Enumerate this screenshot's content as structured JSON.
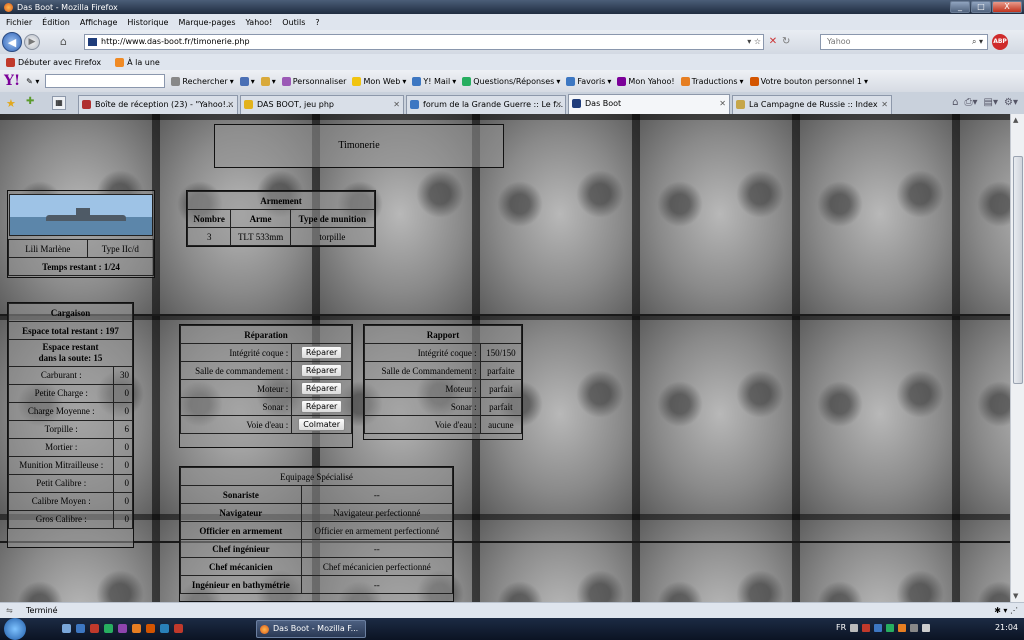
{
  "window": {
    "title": "Das Boot - Mozilla Firefox",
    "min": "_",
    "max": "□",
    "close": "X"
  },
  "menu": [
    "Fichier",
    "Édition",
    "Affichage",
    "Historique",
    "Marque-pages",
    "Yahoo!",
    "Outils",
    "?"
  ],
  "nav": {
    "url": "http://www.das-boot.fr/timonerie.php",
    "search_placeholder": "Yahoo"
  },
  "bookmarks": [
    "Débuter avec Firefox",
    "À la une"
  ],
  "yahoo_toolbar": {
    "logo": "Y!",
    "items": [
      "Rechercher",
      "Personnaliser",
      "Mon Web",
      "Y! Mail",
      "Questions/Réponses",
      "Favoris",
      "Mon Yahoo!",
      "Traductions",
      "Votre bouton personnel 1"
    ]
  },
  "tabs": [
    {
      "label": "Boîte de réception (23) - \"Yahoo!...",
      "color": "#b03030"
    },
    {
      "label": "DAS BOOT, jeu php",
      "color": "#e2b21c"
    },
    {
      "label": "forum de la Grande Guerre :: Le f...",
      "color": "#3d77c2"
    },
    {
      "label": "Das Boot",
      "color": "#1f3c7a",
      "active": true
    },
    {
      "label": "La Campagne de Russie :: Index",
      "color": "#c6a64a"
    }
  ],
  "page": {
    "title": "Timonerie",
    "sub": {
      "name": "Lili Marlène",
      "type": "Type IIc/d",
      "time_left": "Temps restant : 1/24"
    },
    "armement": {
      "title": "Armement",
      "headers": [
        "Nombre",
        "Arme",
        "Type de munition"
      ],
      "rows": [
        [
          "3",
          "TLT 533mm",
          "torpille"
        ]
      ]
    },
    "cargaison": {
      "title": "Cargaison",
      "espace_total": "Espace total restant : 197",
      "espace_soute_1": "Espace restant",
      "espace_soute_2": "dans la soute: 15",
      "rows": [
        {
          "label": "Carburant :",
          "value": "30"
        },
        {
          "label": "Petite Charge :",
          "value": "0"
        },
        {
          "label": "Charge Moyenne :",
          "value": "0"
        },
        {
          "label": "Torpille :",
          "value": "6"
        },
        {
          "label": "Mortier :",
          "value": "0"
        },
        {
          "label": "Munition Mitrailleuse :",
          "value": "0"
        },
        {
          "label": "Petit Calibre :",
          "value": "0"
        },
        {
          "label": "Calibre Moyen :",
          "value": "0"
        },
        {
          "label": "Gros Calibre :",
          "value": "0"
        }
      ]
    },
    "reparation": {
      "title": "Réparation",
      "rows": [
        {
          "label": "Intégrité coque :",
          "button": "Réparer"
        },
        {
          "label": "Salle de commandement :",
          "button": "Réparer"
        },
        {
          "label": "Moteur :",
          "button": "Réparer"
        },
        {
          "label": "Sonar :",
          "button": "Réparer"
        },
        {
          "label": "Voie d'eau :",
          "button": "Colmater"
        }
      ]
    },
    "rapport": {
      "title": "Rapport",
      "rows": [
        {
          "label": "Intégrité coque :",
          "value": "150/150"
        },
        {
          "label": "Salle de Commandement :",
          "value": "parfaite"
        },
        {
          "label": "Moteur :",
          "value": "parfait"
        },
        {
          "label": "Sonar :",
          "value": "parfait"
        },
        {
          "label": "Voie d'eau :",
          "value": "aucune"
        }
      ]
    },
    "equipage": {
      "title": "Equipage Spécialisé",
      "rows": [
        {
          "role": "Sonariste",
          "value": "--"
        },
        {
          "role": "Navigateur",
          "value": "Navigateur perfectionné"
        },
        {
          "role": "Officier en armement",
          "value": "Officier en armement perfectionné"
        },
        {
          "role": "Chef ingénieur",
          "value": "--"
        },
        {
          "role": "Chef mécanicien",
          "value": "Chef mécanicien perfectionné"
        },
        {
          "role": "Ingénieur en bathymétrie",
          "value": "--"
        }
      ]
    }
  },
  "status": "Terminé",
  "taskbar": {
    "window_button": "Das Boot - Mozilla F...",
    "lang": "FR",
    "clock": "21:04"
  }
}
